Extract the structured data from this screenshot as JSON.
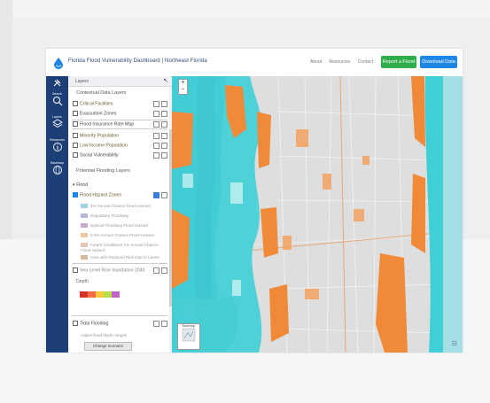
{
  "header": {
    "title": "Florida Flood Vulnerability Dashboard | Northeast Florida",
    "nav": [
      "About",
      "Resources",
      "Contact"
    ],
    "primary_button": "Report a Flood",
    "secondary_button": "Download Data"
  },
  "rail": [
    {
      "label": "Search",
      "icon": "search-icon"
    },
    {
      "label": "Layers",
      "icon": "layers-icon"
    },
    {
      "label": "Resources",
      "icon": "info-icon"
    },
    {
      "label": "Basemap",
      "icon": "globe-icon"
    }
  ],
  "panel": {
    "title": "Layers",
    "section_context": "Contextual Data Layers",
    "layers": [
      {
        "label": "Critical Facilities",
        "checked": true
      },
      {
        "label": "Evacuation Zones",
        "checked": false
      },
      {
        "label": "Flood Insurance Rate Map",
        "checked": false
      },
      {
        "label": "Minority Population",
        "checked": false
      },
      {
        "label": "Low Income Population",
        "checked": false
      },
      {
        "label": "Social Vulnerability",
        "checked": false
      }
    ],
    "section_flooding": "Potential Flooding Layers",
    "flooding_group": "Flood",
    "flood_layer": "Flood Hazard Zones",
    "legend": [
      {
        "label": "1% Annual Chance Flood Hazard",
        "color": "#9fd3e6"
      },
      {
        "label": "Regulatory Floodway",
        "color": "#b7b7d6"
      },
      {
        "label": "Special Floodway Flood Hazard",
        "color": "#c7a7c9"
      },
      {
        "label": "0.2% Annual Chance Flood Hazard",
        "color": "#f1c9a0"
      },
      {
        "label": "Future Conditions 1% Annual Chance Flood Hazard",
        "color": "#e3c6b6"
      },
      {
        "label": "Area with Reduced Risk Due to Levee",
        "color": "#d9b79b"
      }
    ],
    "second_flood_layer": "Sea Level Rise Inundation 2040",
    "depth_label": "Depth",
    "depth_colors": [
      "#d73027",
      "#f46d43",
      "#f9c93e",
      "#b6e04a",
      "#c064c8"
    ],
    "bottom_layer": "Tidal Flooding",
    "bottom_sub": "Adjust flood depth ranges",
    "bottom_button": "Change Scenario"
  },
  "map": {
    "zoom_in": "+",
    "zoom_out": "−",
    "basemap_label": "Basemap",
    "water_color": "#45d1d8",
    "flood_color": "#f08a38",
    "land_color": "#dcdcdc",
    "ocean_color": "#3fd0d6"
  }
}
